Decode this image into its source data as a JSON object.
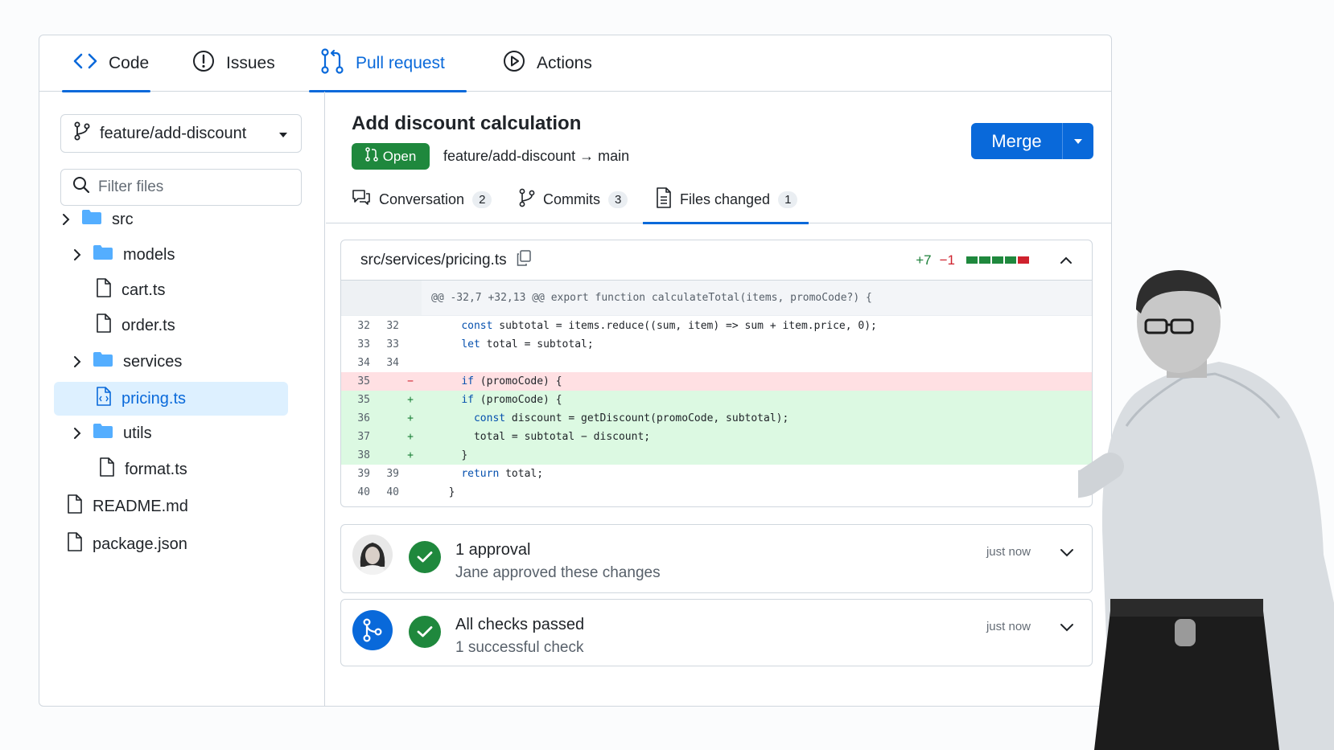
{
  "topnav": {
    "tabs": [
      {
        "label": "Code",
        "icon": "code-icon"
      },
      {
        "label": "Issues",
        "icon": "issue-icon"
      },
      {
        "label": "Pull request",
        "icon": "pull-request-icon",
        "active": true
      },
      {
        "label": "Actions",
        "icon": "play-icon"
      }
    ]
  },
  "sidebar": {
    "branch": "feature/add-discount",
    "filter_placeholder": "Filter files",
    "tree": [
      {
        "label": "src",
        "type": "folder"
      },
      {
        "label": "models",
        "type": "folder"
      },
      {
        "label": "cart.ts",
        "type": "file"
      },
      {
        "label": "order.ts",
        "type": "file"
      },
      {
        "label": "services",
        "type": "folder"
      },
      {
        "label": "pricing.ts",
        "type": "file",
        "selected": true
      },
      {
        "label": "utils",
        "type": "folder"
      },
      {
        "label": "format.ts",
        "type": "file"
      },
      {
        "label": "README.md",
        "type": "file"
      },
      {
        "label": "package.json",
        "type": "file"
      }
    ]
  },
  "pr": {
    "title": "Add discount calculation",
    "status": "Open",
    "branches": "feature/add-discount → main",
    "merge_label": "Merge",
    "tabs": [
      {
        "label": "Conversation",
        "count": "2",
        "icon": "comment-icon"
      },
      {
        "label": "Commits",
        "count": "3",
        "icon": "commit-icon"
      },
      {
        "label": "Files changed",
        "count": "1",
        "icon": "file-diff-icon",
        "active": true
      }
    ]
  },
  "diff": {
    "file": "src/services/pricing.ts",
    "additions": "+7",
    "deletions": "−1",
    "hunk": "@@ -32,7 +32,13 @@ export function calculateTotal(items, promoCode?) {",
    "lines": [
      {
        "old": "32",
        "new": "32",
        "sign": "",
        "kind": "ctx",
        "kw": "const",
        "rest": " subtotal = items.reduce((sum, item) => sum + item.price, 0);",
        "indent": "    "
      },
      {
        "old": "33",
        "new": "33",
        "sign": "",
        "kind": "ctx",
        "kw": "let",
        "rest": " total = subtotal;",
        "indent": "    "
      },
      {
        "old": "34",
        "new": "34",
        "sign": "",
        "kind": "ctx",
        "kw": "",
        "rest": "",
        "indent": ""
      },
      {
        "old": "35",
        "new": "",
        "sign": "−",
        "kind": "del",
        "kw": "if",
        "rest": " (promoCode) {",
        "indent": "    "
      },
      {
        "old": "35",
        "new": "",
        "sign": "+",
        "kind": "add",
        "kw": "if",
        "rest": " (promoCode) {",
        "indent": "    "
      },
      {
        "old": "36",
        "new": "",
        "sign": "+",
        "kind": "add",
        "kw": "const",
        "rest": " discount = getDiscount(promoCode, subtotal);",
        "indent": "      "
      },
      {
        "old": "37",
        "new": "",
        "sign": "+",
        "kind": "add",
        "kw": "",
        "rest": "total = subtotal − discount;",
        "indent": "      "
      },
      {
        "old": "38",
        "new": "",
        "sign": "+",
        "kind": "add",
        "kw": "",
        "rest": "}",
        "indent": "    "
      },
      {
        "old": "39",
        "new": "39",
        "sign": "",
        "kind": "ctx",
        "kw": "return",
        "rest": " total;",
        "indent": "    "
      },
      {
        "old": "40",
        "new": "40",
        "sign": "",
        "kind": "ctx",
        "kw": "",
        "rest": "}",
        "indent": "  "
      }
    ]
  },
  "reviews": [
    {
      "title": "1 approval",
      "subtitle": "Jane approved these changes",
      "time": "just now",
      "icon": "avatar"
    },
    {
      "title": "All checks passed",
      "subtitle": "1 successful check",
      "time": "just now",
      "icon": "git-branch-icon"
    }
  ],
  "colors": {
    "accent": "#0969da",
    "success": "#1f883d",
    "danger": "#cf222e",
    "add_bg": "#dcf9e2",
    "del_bg": "#ffe0e3"
  }
}
